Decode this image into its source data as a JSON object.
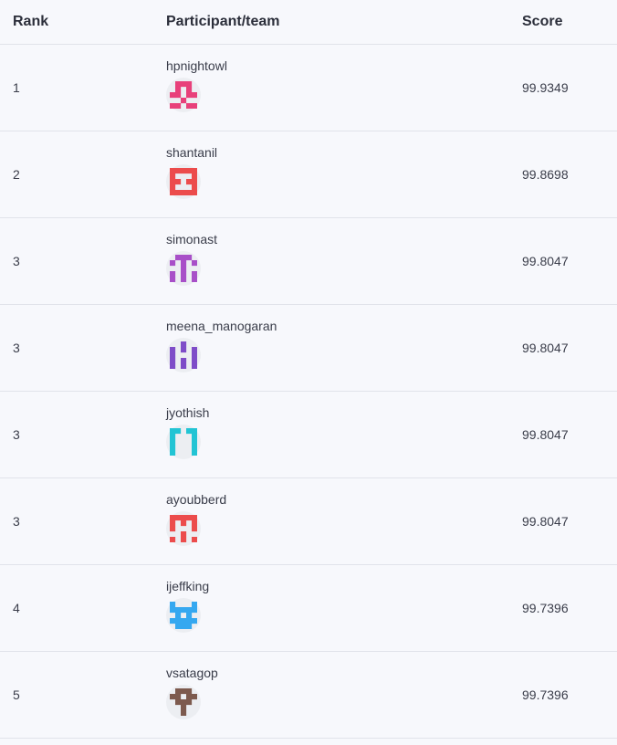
{
  "header": {
    "rank": "Rank",
    "participant": "Participant/team",
    "score": "Score"
  },
  "rows": [
    {
      "rank": "1",
      "name": "hpnightowl",
      "score": "99.9349",
      "avatar_color": "#e8407a",
      "avatar_icon": "identicon-icon"
    },
    {
      "rank": "2",
      "name": "shantanil",
      "score": "99.8698",
      "avatar_color": "#ec4c4c",
      "avatar_icon": "identicon-icon"
    },
    {
      "rank": "3",
      "name": "simonast",
      "score": "99.8047",
      "avatar_color": "#a84fc8",
      "avatar_icon": "identicon-icon"
    },
    {
      "rank": "3",
      "name": "meena_manogaran",
      "score": "99.8047",
      "avatar_color": "#7e4cc8",
      "avatar_icon": "identicon-icon"
    },
    {
      "rank": "3",
      "name": "jyothish",
      "score": "99.8047",
      "avatar_color": "#22c4d4",
      "avatar_icon": "identicon-icon"
    },
    {
      "rank": "3",
      "name": "ayoubberd",
      "score": "99.8047",
      "avatar_color": "#ec4c4c",
      "avatar_icon": "identicon-icon"
    },
    {
      "rank": "4",
      "name": "ijeffking",
      "score": "99.7396",
      "avatar_color": "#35a8f0",
      "avatar_icon": "identicon-icon"
    },
    {
      "rank": "5",
      "name": "vsatagop",
      "score": "99.7396",
      "avatar_color": "#7d5a4e",
      "avatar_icon": "identicon-icon"
    }
  ]
}
